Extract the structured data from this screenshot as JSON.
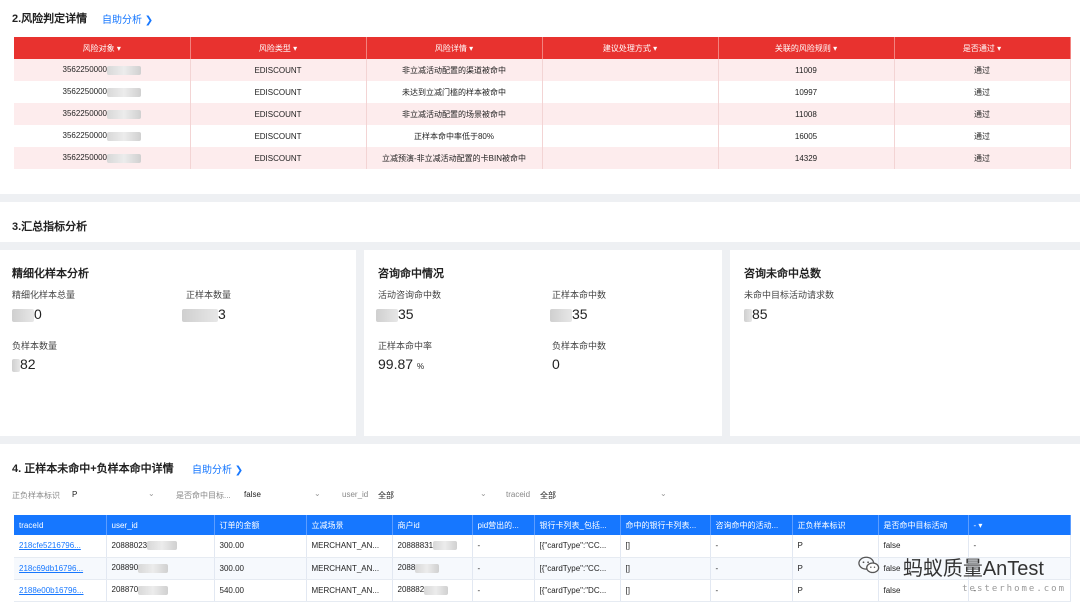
{
  "section2": {
    "title": "2.风险判定详情",
    "link": "自助分析 ❯",
    "headers": [
      "风险对象 ▾",
      "风险类型 ▾",
      "风险详情 ▾",
      "建议处理方式 ▾",
      "关联的风险规则 ▾",
      "是否通过 ▾"
    ],
    "rows": [
      {
        "object": "3562250000",
        "type": "EDISCOUNT",
        "detail": "非立减活动配置的渠道被命中",
        "advice": "",
        "rule": "11009",
        "pass": "通过"
      },
      {
        "object": "3562250000",
        "type": "EDISCOUNT",
        "detail": "未达到立减门槛的样本被命中",
        "advice": "",
        "rule": "10997",
        "pass": "通过"
      },
      {
        "object": "3562250000",
        "type": "EDISCOUNT",
        "detail": "非立减活动配置的场景被命中",
        "advice": "",
        "rule": "11008",
        "pass": "通过"
      },
      {
        "object": "3562250000",
        "type": "EDISCOUNT",
        "detail": "正样本命中率低于80%",
        "advice": "",
        "rule": "16005",
        "pass": "通过"
      },
      {
        "object": "3562250000",
        "type": "EDISCOUNT",
        "detail": "立减预演-非立减活动配置的卡BIN被命中",
        "advice": "",
        "rule": "14329",
        "pass": "通过"
      }
    ]
  },
  "section3": {
    "title": "3.汇总指标分析",
    "cards": [
      {
        "title": "精细化样本分析",
        "metrics": [
          {
            "label": "精细化样本总量",
            "value": "0"
          },
          {
            "label": "正样本数量",
            "value": "3"
          },
          {
            "label": "负样本数量",
            "value": "82"
          }
        ]
      },
      {
        "title": "咨询命中情况",
        "metrics": [
          {
            "label": "活动咨询命中数",
            "value": "35"
          },
          {
            "label": "正样本命中数",
            "value": "35"
          },
          {
            "label": "正样本命中率",
            "value": "99.87",
            "unit": "%"
          },
          {
            "label": "负样本命中数",
            "value": "0"
          }
        ]
      },
      {
        "title": "咨询未命中总数",
        "metrics": [
          {
            "label": "未命中目标活动请求数",
            "value": "85"
          }
        ]
      }
    ]
  },
  "section4": {
    "title": "4. 正样本未命中+负样本命中详情",
    "link": "自助分析 ❯",
    "filters": [
      {
        "label": "正负样本标识",
        "value": "P"
      },
      {
        "label": "是否命中目标...",
        "value": "false"
      },
      {
        "label": "user_id",
        "value": "全部"
      },
      {
        "label": "traceid",
        "value": "全部"
      }
    ],
    "headers": [
      "traceId",
      "user_id",
      "订单的金额",
      "立减场景",
      "商户id",
      "pid营出的...",
      "银行卡列表_包括...",
      "命中的银行卡列表...",
      "咨询命中的活动...",
      "正负样本标识",
      "是否命中目标活动",
      "- ▾"
    ],
    "rows": [
      {
        "traceid": "218cfe5216796...",
        "user_id": "20888023",
        "amount": "300.00",
        "scene": "MERCHANT_AN...",
        "merchant": "20888831",
        "pid": "-",
        "cards": "[{\"cardType\":\"CC...",
        "hit_cards": "[]",
        "hit_act": "-",
        "label": "P",
        "hit_target": "false",
        "extra": "-"
      },
      {
        "traceid": "218c69db16796...",
        "user_id": "208890",
        "amount": "300.00",
        "scene": "MERCHANT_AN...",
        "merchant": "2088",
        "pid": "-",
        "cards": "[{\"cardType\":\"CC...",
        "hit_cards": "[]",
        "hit_act": "-",
        "label": "P",
        "hit_target": "false",
        "extra": "-"
      },
      {
        "traceid": "2188e00b16796...",
        "user_id": "208870",
        "amount": "540.00",
        "scene": "MERCHANT_AN...",
        "merchant": "208882",
        "pid": "-",
        "cards": "[{\"cardType\":\"DC...",
        "hit_cards": "[]",
        "hit_act": "-",
        "label": "P",
        "hit_target": "false",
        "extra": "-"
      }
    ]
  },
  "watermark": {
    "text": "蚂蚁质量AnTest",
    "sub": "testerhome.com"
  },
  "colors": {
    "risk_header": "#e8322f",
    "detail_header": "#1677ff",
    "link": "#1677ff"
  }
}
